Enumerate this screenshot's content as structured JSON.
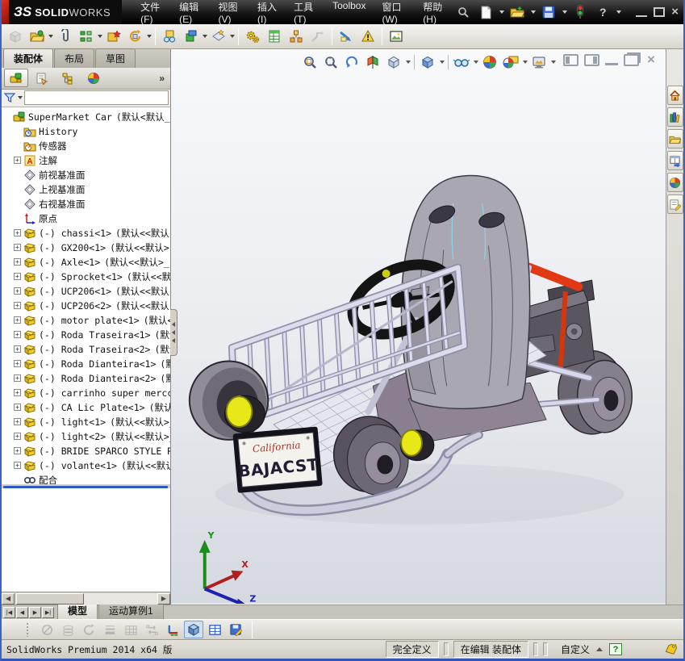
{
  "titlebar": {
    "logo_3s": "ЗS",
    "logo_solid": "SOLID",
    "logo_works": "WORKS",
    "menus": [
      {
        "label": "文件(F)"
      },
      {
        "label": "编辑(E)"
      },
      {
        "label": "视图(V)"
      },
      {
        "label": "插入(I)"
      },
      {
        "label": "工具(T)"
      },
      {
        "label": "Toolbox"
      },
      {
        "label": "窗口(W)"
      },
      {
        "label": "帮助(H)"
      }
    ]
  },
  "command_tabs": {
    "tabs": [
      {
        "label": "装配体",
        "active": true
      },
      {
        "label": "布局",
        "active": false
      },
      {
        "label": "草图",
        "active": false
      }
    ]
  },
  "feature_panel": {
    "tree": [
      {
        "label": "SuperMarket Car",
        "suffix": "(默认<默认_显",
        "icon": "assembly",
        "expand": false,
        "child": false
      },
      {
        "label": "History",
        "suffix": "",
        "icon": "history",
        "expand": false,
        "child": true
      },
      {
        "label": "传感器",
        "suffix": "",
        "icon": "sensors",
        "expand": false,
        "child": true
      },
      {
        "label": "注解",
        "suffix": "",
        "icon": "note",
        "expand": true,
        "child": true
      },
      {
        "label": "前视基准面",
        "suffix": "",
        "icon": "plane",
        "expand": false,
        "child": true
      },
      {
        "label": "上视基准面",
        "suffix": "",
        "icon": "plane",
        "expand": false,
        "child": true
      },
      {
        "label": "右视基准面",
        "suffix": "",
        "icon": "plane",
        "expand": false,
        "child": true
      },
      {
        "label": "原点",
        "suffix": "",
        "icon": "origin",
        "expand": false,
        "child": true
      },
      {
        "label": "(-) chassi<1>",
        "suffix": "(默认<<默认",
        "icon": "part",
        "expand": true,
        "child": true
      },
      {
        "label": "(-) GX200<1>",
        "suffix": "(默认<<默认>",
        "icon": "part",
        "expand": true,
        "child": true
      },
      {
        "label": "(-) Axle<1>",
        "suffix": "(默认<<默认>_",
        "icon": "part",
        "expand": true,
        "child": true
      },
      {
        "label": "(-) Sprocket<1>",
        "suffix": "(默认<<默",
        "icon": "part",
        "expand": true,
        "child": true
      },
      {
        "label": "(-) UCP206<1>",
        "suffix": "(默认<<默认",
        "icon": "part",
        "expand": true,
        "child": true
      },
      {
        "label": "(-) UCP206<2>",
        "suffix": "(默认<<默认",
        "icon": "part",
        "expand": true,
        "child": true
      },
      {
        "label": "(-) motor plate<1>",
        "suffix": "(默认<",
        "icon": "part",
        "expand": true,
        "child": true
      },
      {
        "label": "(-) Roda Traseira<1>",
        "suffix": "(默认",
        "icon": "part",
        "expand": true,
        "child": true
      },
      {
        "label": "(-) Roda Traseira<2>",
        "suffix": "(默认",
        "icon": "part",
        "expand": true,
        "child": true
      },
      {
        "label": "(-) Roda Dianteira<1>",
        "suffix": "(默",
        "icon": "part",
        "expand": true,
        "child": true
      },
      {
        "label": "(-) Roda Dianteira<2>",
        "suffix": "(默",
        "icon": "part",
        "expand": true,
        "child": true
      },
      {
        "label": "(-) carrinho super mercca",
        "suffix": "",
        "icon": "part",
        "expand": true,
        "child": true
      },
      {
        "label": "(-) CA Lic Plate<1>",
        "suffix": "(默认",
        "icon": "part",
        "expand": true,
        "child": true
      },
      {
        "label": "(-) light<1>",
        "suffix": "(默认<<默认>_",
        "icon": "part",
        "expand": true,
        "child": true
      },
      {
        "label": "(-) light<2>",
        "suffix": "(默认<<默认>_",
        "icon": "part",
        "expand": true,
        "child": true
      },
      {
        "label": "(-) BRIDE SPARCO STYLE RA",
        "suffix": "",
        "icon": "part",
        "expand": true,
        "child": true
      },
      {
        "label": "(-) volante<1>",
        "suffix": "(默认<<默认",
        "icon": "part",
        "expand": true,
        "child": true
      },
      {
        "label": "配合",
        "suffix": "",
        "icon": "mates",
        "expand": false,
        "child": true
      }
    ]
  },
  "viewport": {
    "license_plate": {
      "script": "California",
      "number": "BAJACST"
    },
    "triad": {
      "x": "X",
      "y": "Y",
      "z": "Z"
    }
  },
  "doc_tabs": {
    "tabs": [
      {
        "label": "模型",
        "active": true
      },
      {
        "label": "运动算例1",
        "active": false
      }
    ]
  },
  "statusbar": {
    "app_version": "SolidWorks Premium 2014 x64 版",
    "definition": "完全定义",
    "editing": "在编辑 装配体",
    "custom": "自定义"
  }
}
